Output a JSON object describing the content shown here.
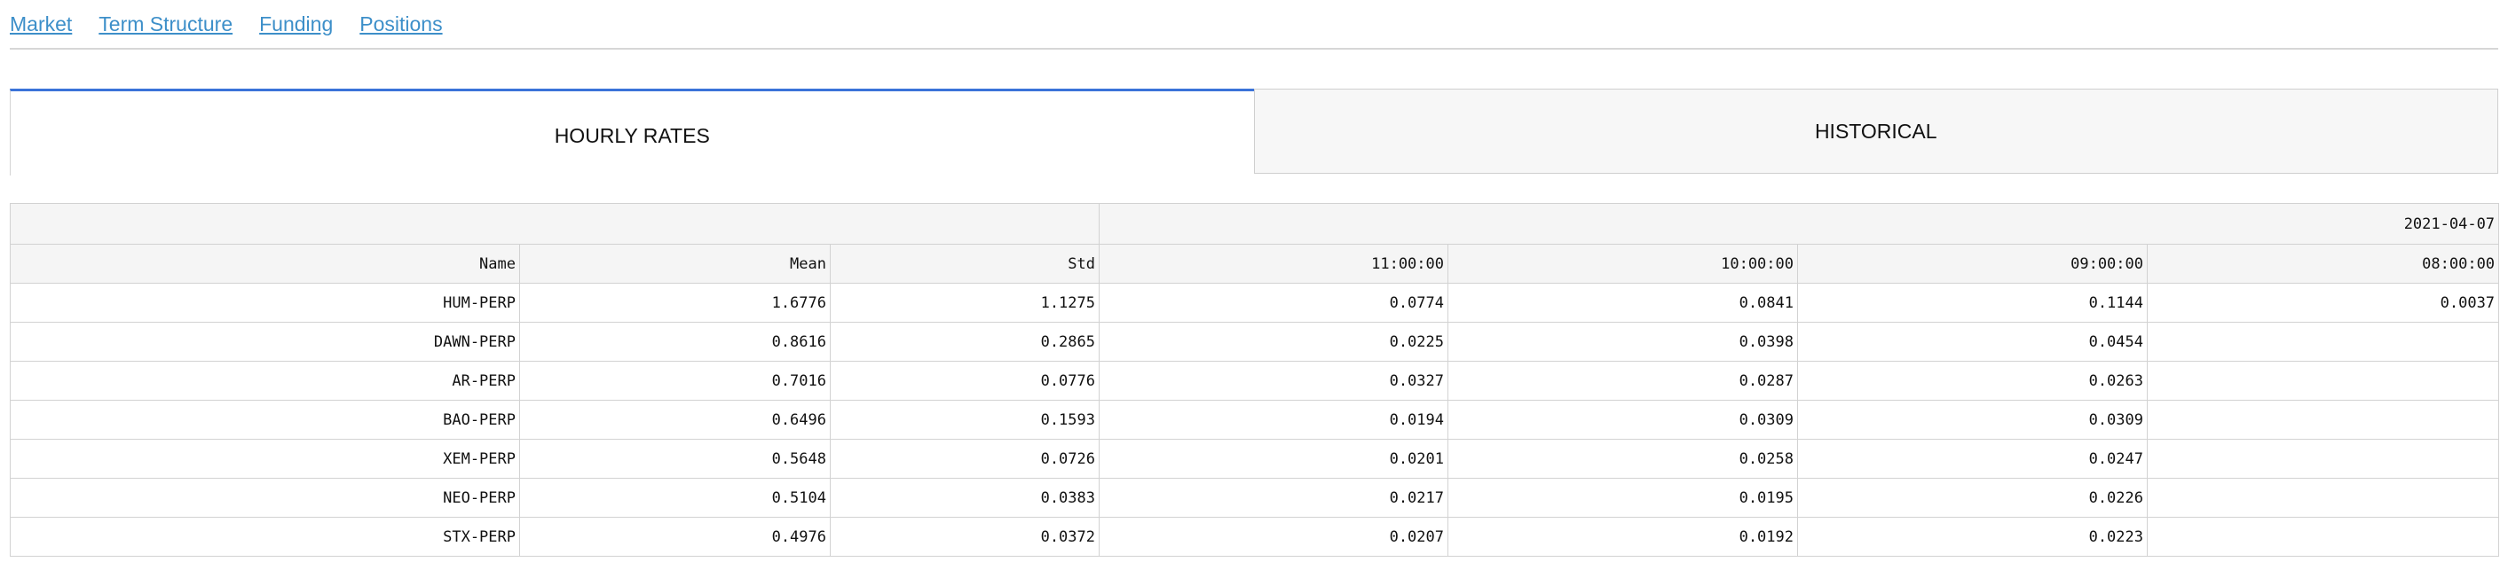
{
  "nav": {
    "links": [
      "Market",
      "Term Structure",
      "Funding",
      "Positions"
    ]
  },
  "tabs": {
    "active": "HOURLY RATES",
    "inactive": "HISTORICAL"
  },
  "colors": {
    "link": "#3d8fc9",
    "active_tab_accent": "#3b73d9",
    "header_bg": "#f5f5f5"
  },
  "table": {
    "group_header": {
      "left": "",
      "right": "2021-04-07"
    },
    "columns": [
      "Name",
      "Mean",
      "Std",
      "11:00:00",
      "10:00:00",
      "09:00:00",
      "08:00:00"
    ],
    "rows": [
      [
        "HUM-PERP",
        "1.6776",
        "1.1275",
        "0.0774",
        "0.0841",
        "0.1144",
        "0.0037"
      ],
      [
        "DAWN-PERP",
        "0.8616",
        "0.2865",
        "0.0225",
        "0.0398",
        "0.0454",
        ""
      ],
      [
        "AR-PERP",
        "0.7016",
        "0.0776",
        "0.0327",
        "0.0287",
        "0.0263",
        ""
      ],
      [
        "BAO-PERP",
        "0.6496",
        "0.1593",
        "0.0194",
        "0.0309",
        "0.0309",
        ""
      ],
      [
        "XEM-PERP",
        "0.5648",
        "0.0726",
        "0.0201",
        "0.0258",
        "0.0247",
        ""
      ],
      [
        "NEO-PERP",
        "0.5104",
        "0.0383",
        "0.0217",
        "0.0195",
        "0.0226",
        ""
      ],
      [
        "STX-PERP",
        "0.4976",
        "0.0372",
        "0.0207",
        "0.0192",
        "0.0223",
        ""
      ]
    ]
  }
}
